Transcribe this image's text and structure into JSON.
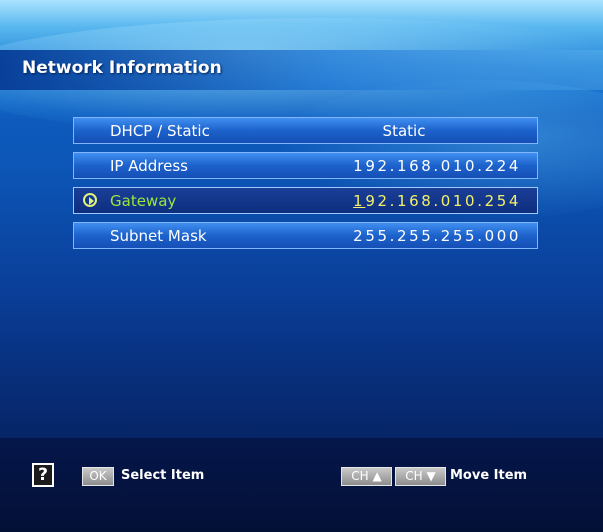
{
  "title": "Network Information",
  "rows": [
    {
      "label": "DHCP / Static",
      "value": "Static"
    },
    {
      "label": "IP Address",
      "value": "192.168.010.224"
    },
    {
      "label": "Gateway",
      "value_first": "1",
      "value_rest": "92.168.010.254"
    },
    {
      "label": "Subnet Mask",
      "value": "255.255.255.000"
    }
  ],
  "footer": {
    "help_icon": "?",
    "ok_key": "OK",
    "select_hint": "Select Item",
    "ch_up_key": "CH ▲",
    "ch_down_key": "CH ▼",
    "move_hint": "Move Item"
  },
  "colors": {
    "selected_label": "#9be63a",
    "selected_value": "#f2f06a"
  }
}
